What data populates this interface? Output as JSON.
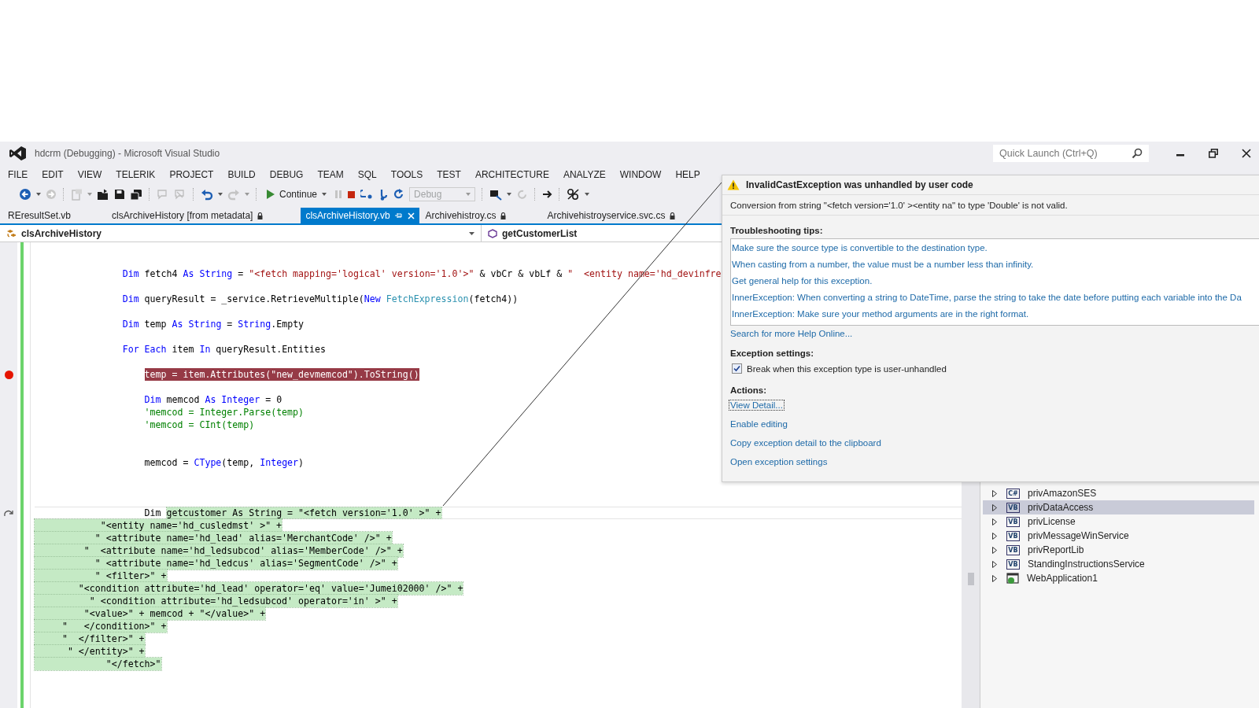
{
  "window": {
    "title": "hdcrm (Debugging) - Microsoft Visual Studio",
    "quick_launch": {
      "placeholder": "Quick Launch (Ctrl+Q)"
    }
  },
  "menu": [
    "FILE",
    "EDIT",
    "VIEW",
    "TELERIK",
    "PROJECT",
    "BUILD",
    "DEBUG",
    "TEAM",
    "SQL",
    "TOOLS",
    "TEST",
    "ARCHITECTURE",
    "ANALYZE",
    "WINDOW",
    "HELP"
  ],
  "toolbar": {
    "continue": "Continue",
    "configuration": {
      "value": "Debug",
      "disabled": true
    }
  },
  "tabs": [
    {
      "label": "REresultSet.vb",
      "selected": false,
      "locked": false
    },
    {
      "label": "clsArchiveHistory [from metadata]",
      "selected": false,
      "locked": true
    },
    {
      "label": "clsArchiveHistory.vb",
      "selected": true,
      "locked": false
    },
    {
      "label": "Archivehistroy.cs",
      "selected": false,
      "locked": true
    },
    {
      "label": "Archivehistroyservice.svc.cs",
      "selected": false,
      "locked": true
    }
  ],
  "nav": {
    "type": "clsArchiveHistory",
    "member": "getCustomerList"
  },
  "code": [
    {
      "kind": "blank"
    },
    {
      "kind": "blank"
    },
    {
      "tokens": [
        {
          "text": "                Dim",
          "kind": "kw"
        },
        {
          "text": " fetch4 ",
          "kind": "plain"
        },
        {
          "text": "As",
          "kind": "kw"
        },
        {
          "text": " String",
          "kind": "kw"
        },
        {
          "text": " = ",
          "kind": "plain"
        },
        {
          "text": "\"<fetch mapping='logical' version='1.0'>\"",
          "kind": "str"
        },
        {
          "text": " & vbCr & vbLf & ",
          "kind": "plain"
        },
        {
          "text": "\"  <entity name='hd_devinfre",
          "kind": "str"
        }
      ],
      "breakpoint": false,
      "selected": false,
      "current": false
    },
    {
      "kind": "blank"
    },
    {
      "tokens": [
        {
          "text": "                Dim",
          "kind": "kw"
        },
        {
          "text": " queryResult = _service.RetrieveMultiple(",
          "kind": "plain"
        },
        {
          "text": "New",
          "kind": "kw"
        },
        {
          "text": " FetchExpression",
          "kind": "type"
        },
        {
          "text": "(fetch4))",
          "kind": "plain"
        }
      ],
      "breakpoint": false,
      "selected": false,
      "current": false
    },
    {
      "kind": "blank"
    },
    {
      "tokens": [
        {
          "text": "                Dim",
          "kind": "kw"
        },
        {
          "text": " temp ",
          "kind": "plain"
        },
        {
          "text": "As",
          "kind": "kw"
        },
        {
          "text": " String",
          "kind": "kw"
        },
        {
          "text": " = ",
          "kind": "plain"
        },
        {
          "text": "String",
          "kind": "kw"
        },
        {
          "text": ".Empty",
          "kind": "plain"
        }
      ],
      "breakpoint": false,
      "selected": false,
      "current": false
    },
    {
      "kind": "blank"
    },
    {
      "tokens": [
        {
          "text": "                For Each",
          "kind": "kw"
        },
        {
          "text": " item ",
          "kind": "plain"
        },
        {
          "text": "In",
          "kind": "kw"
        },
        {
          "text": " queryResult.Entities",
          "kind": "plain"
        }
      ],
      "breakpoint": false,
      "selected": false,
      "current": false
    },
    {
      "kind": "blank"
    },
    {
      "tokens": [
        {
          "text": "                    temp = item.Attributes(\"new_devmemcod\").ToString()",
          "kind": "plain"
        }
      ],
      "breakpoint": true,
      "selected": false,
      "current": false
    },
    {
      "kind": "blank"
    },
    {
      "tokens": [
        {
          "text": "                    Dim",
          "kind": "kw"
        },
        {
          "text": " memcod ",
          "kind": "plain"
        },
        {
          "text": "As",
          "kind": "kw"
        },
        {
          "text": " Integer",
          "kind": "kw"
        },
        {
          "text": " = 0",
          "kind": "plain"
        }
      ],
      "breakpoint": false,
      "selected": false,
      "current": false
    },
    {
      "tokens": [
        {
          "text": "                    'memcod = Integer.Parse(temp)",
          "kind": "cmt"
        }
      ],
      "breakpoint": false,
      "selected": false,
      "current": false
    },
    {
      "tokens": [
        {
          "text": "                    'memcod = CInt(temp)",
          "kind": "cmt"
        }
      ],
      "breakpoint": false,
      "selected": false,
      "current": false
    },
    {
      "kind": "blank"
    },
    {
      "kind": "blank"
    },
    {
      "tokens": [
        {
          "text": "                    memcod = ",
          "kind": "plain"
        },
        {
          "text": "CType",
          "kind": "kw"
        },
        {
          "text": "(temp, ",
          "kind": "plain"
        },
        {
          "text": "Integer",
          "kind": "kw"
        },
        {
          "text": ")",
          "kind": "plain"
        }
      ],
      "breakpoint": false,
      "selected": false,
      "current": false
    },
    {
      "kind": "blank"
    },
    {
      "kind": "blank"
    },
    {
      "kind": "blank"
    },
    {
      "tokens": [
        {
          "text": "                    Dim ",
          "kind": "plain",
          "selected": false
        },
        {
          "text": "getcustomer As String = \"<fetch version='1.0' >\" +",
          "kind": "plain",
          "selected": true
        }
      ],
      "breakpoint": false,
      "selected": false,
      "current": true
    },
    {
      "tokens": [
        {
          "text": "            \"<entity name='hd_cusledmst' >\" +",
          "kind": "plain"
        }
      ],
      "breakpoint": false,
      "selected": true,
      "current": false
    },
    {
      "tokens": [
        {
          "text": "           \" <attribute name='hd_lead' alias='MerchantCode' />\" +",
          "kind": "plain"
        }
      ],
      "breakpoint": false,
      "selected": true,
      "current": false
    },
    {
      "tokens": [
        {
          "text": "         \"  <attribute name='hd_ledsubcod' alias='MemberCode' />\" +",
          "kind": "plain"
        }
      ],
      "breakpoint": false,
      "selected": true,
      "current": false
    },
    {
      "tokens": [
        {
          "text": "           \" <attribute name='hd_ledcus' alias='SegmentCode' />\" +",
          "kind": "plain"
        }
      ],
      "breakpoint": false,
      "selected": true,
      "current": false
    },
    {
      "tokens": [
        {
          "text": "           \" <filter>\" +",
          "kind": "plain"
        }
      ],
      "breakpoint": false,
      "selected": true,
      "current": false
    },
    {
      "tokens": [
        {
          "text": "        \"<condition attribute='hd_lead' operator='eq' value='Jumei02000' />\" +",
          "kind": "plain"
        }
      ],
      "breakpoint": false,
      "selected": true,
      "current": false
    },
    {
      "tokens": [
        {
          "text": "          \" <condition attribute='hd_ledsubcod' operator='in' >\" +",
          "kind": "plain"
        }
      ],
      "breakpoint": false,
      "selected": true,
      "current": false
    },
    {
      "tokens": [
        {
          "text": "         \"<value>\" + memcod + \"</value>\" +",
          "kind": "plain"
        }
      ],
      "breakpoint": false,
      "selected": true,
      "current": false
    },
    {
      "tokens": [
        {
          "text": "     \"   </condition>\" +",
          "kind": "plain"
        }
      ],
      "breakpoint": false,
      "selected": true,
      "current": false
    },
    {
      "tokens": [
        {
          "text": "     \"  </filter>\" +",
          "kind": "plain"
        }
      ],
      "breakpoint": false,
      "selected": true,
      "current": false
    },
    {
      "tokens": [
        {
          "text": "      \" </entity>\" +",
          "kind": "plain"
        }
      ],
      "breakpoint": false,
      "selected": true,
      "current": false
    },
    {
      "tokens": [
        {
          "text": "             \"</fetch>\"",
          "kind": "plain"
        }
      ],
      "breakpoint": false,
      "selected": true,
      "current": false
    }
  ],
  "exception": {
    "title": "InvalidCastException was unhandled by user code",
    "message": "Conversion from string \"<fetch version='1.0' ><entity na\" to type 'Double' is not valid.",
    "tips_heading": "Troubleshooting tips:",
    "tips": [
      "Make sure the source type is convertible to the destination type.",
      "When casting from a number, the value must be a number less than infinity.",
      "Get general help for this exception.",
      "InnerException: When converting a string to DateTime, parse the string to take the date before putting each variable into the Da",
      "InnerException: Make sure your method arguments are in the right format."
    ],
    "search_link": "Search for more Help Online...",
    "settings_heading": "Exception settings:",
    "break_option": {
      "label": "Break when this exception type is user-unhandled",
      "checked": true
    },
    "actions_heading": "Actions:",
    "actions": [
      {
        "label": "View Detail...",
        "focused": true
      },
      {
        "label": "Enable editing",
        "focused": false
      },
      {
        "label": "Copy exception detail to the clipboard",
        "focused": false
      },
      {
        "label": "Open exception settings",
        "focused": false
      }
    ]
  },
  "solution_explorer": {
    "items": [
      {
        "name": "privAmazonSES",
        "kind": "lang",
        "badge": "C#",
        "selected": false
      },
      {
        "name": "privDataAccess",
        "kind": "lang",
        "badge": "VB",
        "selected": true
      },
      {
        "name": "privLicense",
        "kind": "lang",
        "badge": "VB",
        "selected": false
      },
      {
        "name": "privMessageWinService",
        "kind": "lang",
        "badge": "VB",
        "selected": false
      },
      {
        "name": "privReportLib",
        "kind": "lang",
        "badge": "VB",
        "selected": false
      },
      {
        "name": "StandingInstructionsService",
        "kind": "lang",
        "badge": "VB",
        "selected": false
      },
      {
        "name": "WebApplication1",
        "kind": "web",
        "selected": false
      }
    ]
  }
}
